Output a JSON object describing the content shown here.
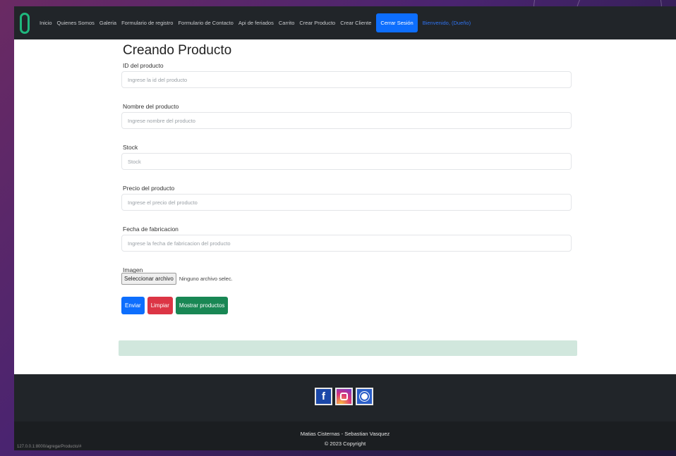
{
  "navbar": {
    "links": [
      "Inicio",
      "Quienes Somos",
      "Galeria",
      "Formulario de registro",
      "Formulario de Contacto",
      "Api de feriados",
      "Carrito",
      "Crear Producto",
      "Crear Cliente"
    ],
    "session_button": "Cerrar Sesión",
    "user_label": "Bienvenido, (Dueño)"
  },
  "form": {
    "title": "Creando Producto",
    "fields": [
      {
        "label": "ID del producto",
        "placeholder": "Ingrese la id del producto"
      },
      {
        "label": "Nombre del producto",
        "placeholder": "Ingrese nombre del producto"
      },
      {
        "label": "Stock",
        "placeholder": "Stock"
      },
      {
        "label": "Precio del producto",
        "placeholder": "Ingrese el precio del producto"
      },
      {
        "label": "Fecha de fabricacion",
        "placeholder": "Ingrese la fecha de fabricacion del producto"
      }
    ],
    "image": {
      "label": "Imagen",
      "button": "Seleccionar archivo",
      "status": "Ninguno archivo selec."
    },
    "buttons": {
      "submit": "Enviar",
      "clear": "Limpiar",
      "show": "Mostrar productos"
    }
  },
  "footer": {
    "social": [
      "facebook-icon",
      "instagram-icon",
      "github-icon"
    ],
    "authors": "Matias Cisternas - Sebastian Vasquez",
    "copyright": "© 2023 Copyright"
  },
  "status_url": "127.0.0.1:8000/agregarProducto/#"
}
